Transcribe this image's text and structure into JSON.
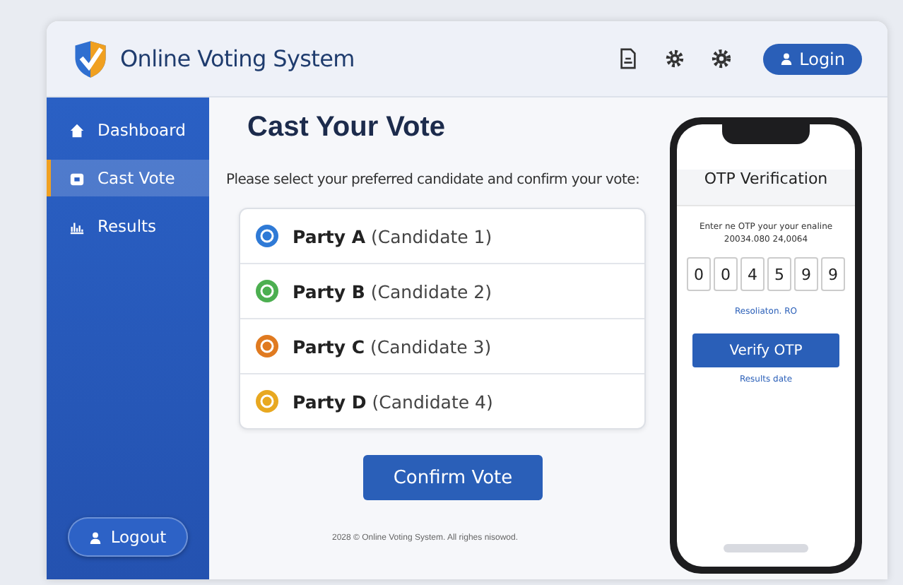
{
  "header": {
    "title": "Online Voting System",
    "login_button": "Login"
  },
  "sidebar": {
    "items": [
      {
        "label": "Dashboard",
        "selected": false
      },
      {
        "label": "Cast Vote",
        "selected": true
      },
      {
        "label": "Results",
        "selected": false
      }
    ],
    "logout_button": "Logout"
  },
  "main": {
    "title": "Cast Your Vote",
    "instruction": "Please select your preferred candidate and confirm your vote:",
    "candidates": [
      {
        "label": "**Party A** (Candidate 1)",
        "color": "#2f7ad6"
      },
      {
        "label": "**Party B** (Candidate 2)",
        "color": "#4caf50"
      },
      {
        "label": "**Party C** (Candidate 3)",
        "color": "#e07a20"
      },
      {
        "label": "**Party D** (Candidate 4)",
        "color": "#e8a820"
      }
    ],
    "confirm_button": "Confirm Vote",
    "footer": "2028 © Online Voting System. All righes nisowod."
  },
  "phone": {
    "title": "OTP Verification",
    "message_lines": [
      "Enter ne OTP your your enaline",
      "20034.080 24,0064"
    ],
    "otp_digits": [
      "0",
      "0",
      "4",
      "5",
      "9",
      "9"
    ],
    "resend_text": "Resoliaton. RO",
    "verify_button": "Verify OTP",
    "results_link": "Results date"
  }
}
